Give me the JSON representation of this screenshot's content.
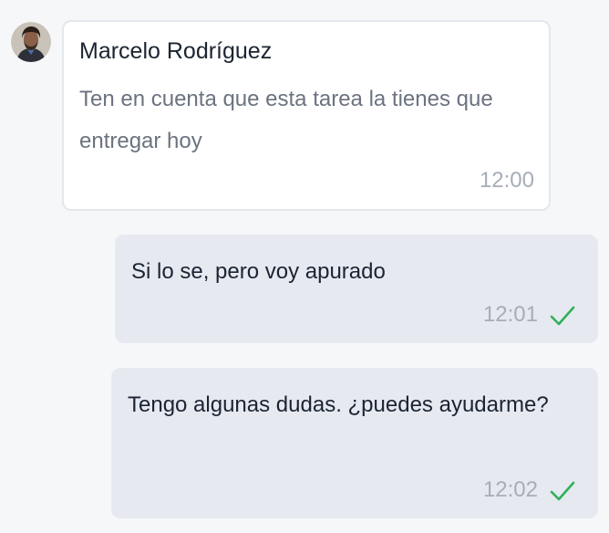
{
  "colors": {
    "page_background": "#f6f7f9",
    "incoming_bubble": "#ffffff",
    "outgoing_bubble": "#e6e9f0",
    "read_check": "#2fb05a",
    "timestamp": "#a6adb8"
  },
  "messages": [
    {
      "direction": "incoming",
      "avatar_icon": "user-avatar",
      "sender": "Marcelo Rodríguez",
      "text": "Ten en cuenta que esta tarea la tienes que entregar hoy",
      "time": "12:00"
    },
    {
      "direction": "outgoing",
      "text": "Si lo se, pero voy apurado",
      "time": "12:01",
      "status_icon": "check-icon"
    },
    {
      "direction": "outgoing",
      "text": "Tengo algunas dudas. ¿puedes ayudarme?",
      "time": "12:02",
      "status_icon": "check-icon"
    }
  ]
}
